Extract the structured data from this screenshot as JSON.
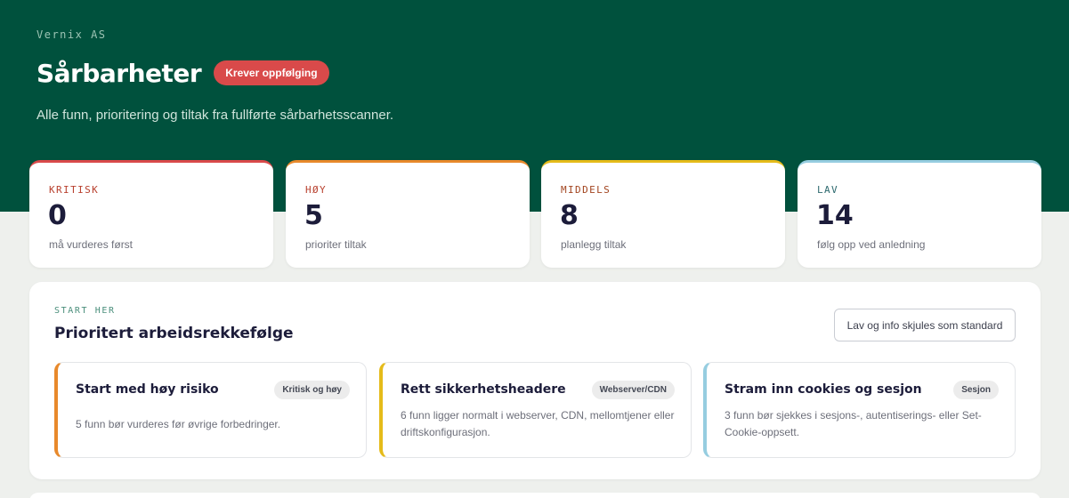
{
  "header": {
    "org": "Vernix AS",
    "title": "Sårbarheter",
    "status_badge": "Krever oppfølging",
    "subtitle": "Alle funn, prioritering og tiltak fra fullførte sårbarhetsscanner."
  },
  "severity_cards": [
    {
      "label": "KRITISK",
      "value": "0",
      "note": "må vurderes først",
      "color": "#d94a4a",
      "label_color": "#b8402e"
    },
    {
      "label": "HØY",
      "value": "5",
      "note": "prioriter tiltak",
      "color": "#e8892b",
      "label_color": "#b8402e"
    },
    {
      "label": "MIDDELS",
      "value": "8",
      "note": "planlegg tiltak",
      "color": "#e5bb1a",
      "label_color": "#a2441f"
    },
    {
      "label": "LAV",
      "value": "14",
      "note": "følg opp ved anledning",
      "color": "#96cde0",
      "label_color": "#2e6a6f"
    }
  ],
  "workflow": {
    "eyebrow": "START HER",
    "title": "Prioritert arbeidsrekkefølge",
    "filter_button": "Lav og info skjules som standard",
    "tasks": [
      {
        "title": "Start med høy risiko",
        "tag": "Kritisk og høy",
        "description": "5 funn bør vurderes før øvrige forbedringer.",
        "accent": "#e8892b"
      },
      {
        "title": "Rett sikkerhetsheadere",
        "tag": "Webserver/CDN",
        "description": "6 funn ligger normalt i webserver, CDN, mellomtjener eller driftskonfigurasjon.",
        "accent": "#e5bb1a"
      },
      {
        "title": "Stram inn cookies og sesjon",
        "tag": "Sesjon",
        "description": "3 funn bør sjekkes i sesjons-, autentiserings- eller Set-Cookie-oppsett.",
        "accent": "#96cde0"
      }
    ]
  }
}
